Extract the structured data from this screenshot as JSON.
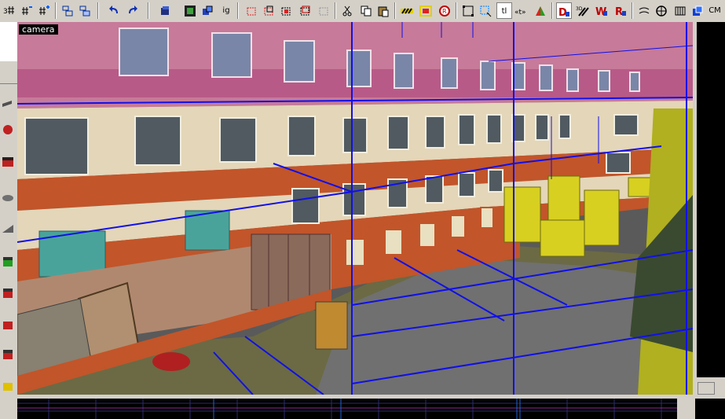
{
  "viewport": {
    "label": "camera"
  },
  "toolbar": {
    "ig_label": "ig",
    "tl_label": "tl",
    "cm_label": "CM",
    "icons": [
      "grid-3d-icon",
      "grid-decrease-icon",
      "grid-increase-icon",
      "group-icon",
      "ungroup-icon",
      "undo-icon",
      "redo-icon",
      "carve-icon",
      "texture-browser-icon",
      "texture-apply-icon",
      "ignore-group-label",
      "hide-icon",
      "hide-unselected-icon",
      "show-icon",
      "show-all-icon",
      "cut-icon",
      "copy-icon",
      "paste-icon",
      "hazard-texture-icon",
      "hazard-select-icon",
      "record-icon",
      "select-box-icon",
      "select-point-icon",
      "texture-lock-icon",
      "arrow-texture-icon",
      "color-split-icon",
      "display-d-icon",
      "3d-wireframe-icon",
      "wireframe-w-icon",
      "red-r-icon",
      "draw-path-icon",
      "sphere-icon",
      "brush-icon",
      "entity-icon",
      "camera-mode-label"
    ]
  },
  "colors": {
    "wire_blue": "#1010e8",
    "sky_pink": "#d08aa0",
    "wall_cream": "#e8d8b8",
    "brick_red": "#c04a20",
    "yellow_block": "#d8d020",
    "grass": "#6a6a3a"
  }
}
